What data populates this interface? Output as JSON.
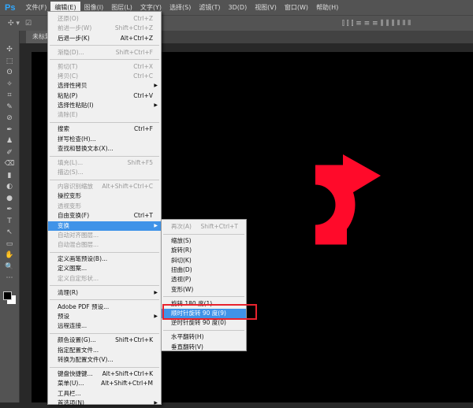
{
  "app": {
    "logo": "Ps",
    "doc_tab": "未标题-"
  },
  "menubar": [
    "文件(F)",
    "编辑(E)",
    "图像(I)",
    "图层(L)",
    "文字(Y)",
    "选择(S)",
    "滤镜(T)",
    "3D(D)",
    "视图(V)",
    "窗口(W)",
    "帮助(H)"
  ],
  "edit_menu": [
    {
      "label": "还原(O)",
      "shortcut": "Ctrl+Z",
      "disabled": true
    },
    {
      "label": "前进一步(W)",
      "shortcut": "Shift+Ctrl+Z",
      "disabled": true
    },
    {
      "label": "后退一步(K)",
      "shortcut": "Alt+Ctrl+Z"
    },
    {
      "sep": true
    },
    {
      "label": "渐隐(D)...",
      "shortcut": "Shift+Ctrl+F",
      "disabled": true
    },
    {
      "sep": true
    },
    {
      "label": "剪切(T)",
      "shortcut": "Ctrl+X",
      "disabled": true
    },
    {
      "label": "拷贝(C)",
      "shortcut": "Ctrl+C",
      "disabled": true
    },
    {
      "label": "选择性拷贝",
      "shortcut": "",
      "submenu": true
    },
    {
      "label": "粘贴(P)",
      "shortcut": "Ctrl+V"
    },
    {
      "label": "选择性粘贴(I)",
      "shortcut": "",
      "submenu": true
    },
    {
      "label": "清除(E)",
      "shortcut": "",
      "disabled": true
    },
    {
      "sep": true
    },
    {
      "label": "搜索",
      "shortcut": "Ctrl+F"
    },
    {
      "label": "拼写检查(H)...",
      "shortcut": ""
    },
    {
      "label": "查找和替换文本(X)...",
      "shortcut": ""
    },
    {
      "sep": true
    },
    {
      "label": "填充(L)...",
      "shortcut": "Shift+F5",
      "disabled": true
    },
    {
      "label": "描边(S)...",
      "shortcut": "",
      "disabled": true
    },
    {
      "sep": true
    },
    {
      "label": "内容识别缩放",
      "shortcut": "Alt+Shift+Ctrl+C",
      "disabled": true
    },
    {
      "label": "操控变形",
      "shortcut": ""
    },
    {
      "label": "透视变形",
      "shortcut": "",
      "disabled": true
    },
    {
      "label": "自由变换(F)",
      "shortcut": "Ctrl+T"
    },
    {
      "label": "变换",
      "shortcut": "",
      "submenu": true,
      "highlighted": true
    },
    {
      "label": "自动对齐图层...",
      "shortcut": "",
      "disabled": true
    },
    {
      "label": "自动混合图层...",
      "shortcut": "",
      "disabled": true
    },
    {
      "sep": true
    },
    {
      "label": "定义画笔预设(B)...",
      "shortcut": ""
    },
    {
      "label": "定义图案...",
      "shortcut": ""
    },
    {
      "label": "定义自定形状...",
      "shortcut": "",
      "disabled": true
    },
    {
      "sep": true
    },
    {
      "label": "清理(R)",
      "shortcut": "",
      "submenu": true
    },
    {
      "sep": true
    },
    {
      "label": "Adobe PDF 预设...",
      "shortcut": ""
    },
    {
      "label": "预设",
      "shortcut": "",
      "submenu": true
    },
    {
      "label": "远程连接...",
      "shortcut": ""
    },
    {
      "sep": true
    },
    {
      "label": "颜色设置(G)...",
      "shortcut": "Shift+Ctrl+K"
    },
    {
      "label": "指定配置文件...",
      "shortcut": ""
    },
    {
      "label": "转换为配置文件(V)...",
      "shortcut": ""
    },
    {
      "sep": true
    },
    {
      "label": "键盘快捷键...",
      "shortcut": "Alt+Shift+Ctrl+K"
    },
    {
      "label": "菜单(U)...",
      "shortcut": "Alt+Shift+Ctrl+M"
    },
    {
      "label": "工具栏...",
      "shortcut": ""
    },
    {
      "label": "首选项(N)",
      "shortcut": "",
      "submenu": true
    }
  ],
  "transform_submenu": [
    {
      "label": "再次(A)",
      "shortcut": "Shift+Ctrl+T",
      "disabled": true
    },
    {
      "sep": true
    },
    {
      "label": "缩放(S)"
    },
    {
      "label": "旋转(R)"
    },
    {
      "label": "斜切(K)"
    },
    {
      "label": "扭曲(D)"
    },
    {
      "label": "透视(P)"
    },
    {
      "label": "变形(W)"
    },
    {
      "sep": true
    },
    {
      "label": "旋转 180 度(1)"
    },
    {
      "label": "顺时针旋转 90 度(9)",
      "highlighted": true
    },
    {
      "label": "逆时针旋转 90 度(0)"
    },
    {
      "sep": true
    },
    {
      "label": "水平翻转(H)"
    },
    {
      "label": "垂直翻转(V)"
    }
  ],
  "colors": {
    "accent": "#3f93e8",
    "arrow": "#ff0a2a",
    "highlight_box": "#e8232e"
  }
}
